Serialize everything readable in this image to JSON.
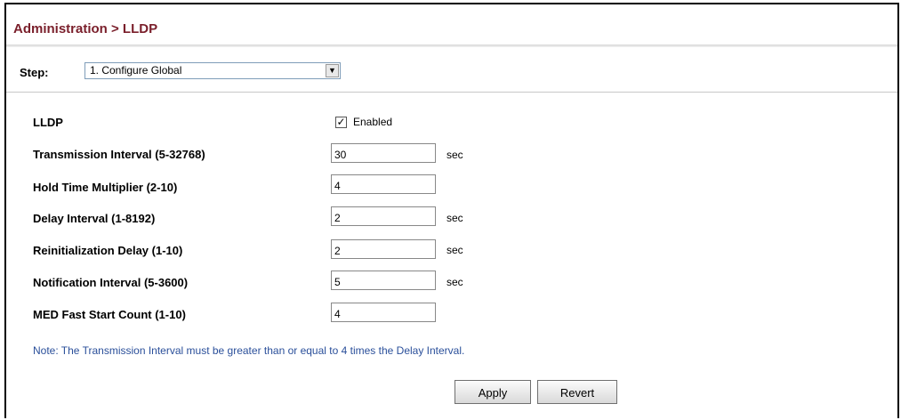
{
  "header": {
    "title": "Administration > LLDP"
  },
  "step": {
    "label": "Step:",
    "selected": "1. Configure Global"
  },
  "form": {
    "lldp": {
      "label": "LLDP",
      "checkbox_checked": true,
      "checkbox_label": "Enabled"
    },
    "rows": [
      {
        "label": "Transmission Interval (5-32768)",
        "value": "30",
        "unit": "sec"
      },
      {
        "label": "Hold Time Multiplier (2-10)",
        "value": "4",
        "unit": ""
      },
      {
        "label": "Delay Interval (1-8192)",
        "value": "2",
        "unit": "sec"
      },
      {
        "label": "Reinitialization Delay (1-10)",
        "value": "2",
        "unit": "sec"
      },
      {
        "label": "Notification Interval (5-3600)",
        "value": "5",
        "unit": "sec"
      },
      {
        "label": "MED Fast Start Count (1-10)",
        "value": "4",
        "unit": ""
      }
    ]
  },
  "note": "Note: The Transmission Interval must be greater than or equal to 4 times the Delay Interval.",
  "buttons": {
    "apply": "Apply",
    "revert": "Revert"
  },
  "colors": {
    "title": "#7a1f2b",
    "note": "#2a4f9a"
  }
}
